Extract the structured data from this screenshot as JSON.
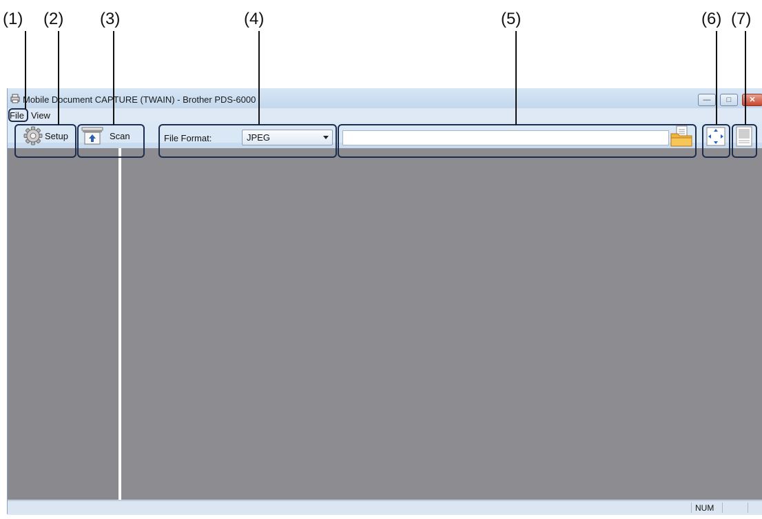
{
  "callouts": [
    "(1)",
    "(2)",
    "(3)",
    "(4)",
    "(5)",
    "(6)",
    "(7)"
  ],
  "window": {
    "title": "Mobile Document CAPTURE (TWAIN) - Brother PDS-6000"
  },
  "menu": [
    "File",
    "View"
  ],
  "toolbar": {
    "setup_label": "Setup",
    "scan_label": "Scan",
    "file_format_label": "File Format:",
    "file_format_value": "JPEG",
    "path_value": ""
  },
  "status": {
    "num": "NUM"
  },
  "colors": {
    "accent_border": "#1c2c4c",
    "window_frame": "#c9dcef",
    "panel_gray": "#8d8c91"
  },
  "icons": [
    "printer-icon",
    "gear-icon",
    "scanner-icon",
    "folder-icon",
    "fit-page-icon",
    "single-page-icon"
  ]
}
